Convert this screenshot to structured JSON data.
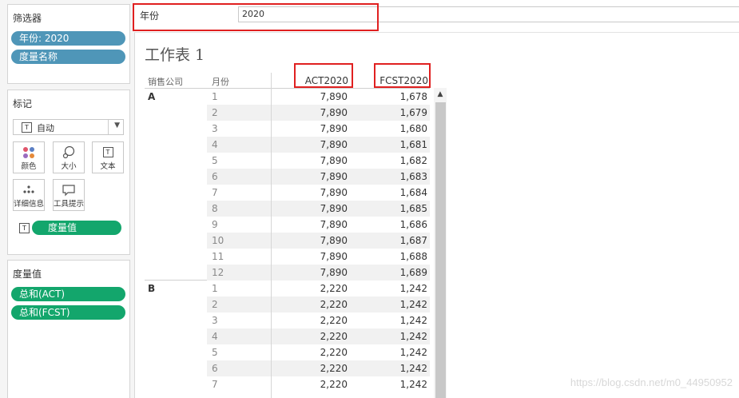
{
  "left_pane": {
    "filters": {
      "title": "筛选器",
      "pills": [
        "年份: 2020",
        "度量名称"
      ]
    },
    "marks": {
      "title": "标记",
      "mark_type": "自动",
      "buttons": {
        "color": "颜色",
        "size": "大小",
        "text": "文本",
        "detail": "详细信息",
        "tooltip": "工具提示"
      },
      "text_pill": "度量值"
    },
    "measure_values": {
      "title": "度量值",
      "pills": [
        "总和(ACT)",
        "总和(FCST)"
      ]
    }
  },
  "filter_bar": {
    "label": "年份",
    "value": "2020"
  },
  "sheet": {
    "title": "工作表 1",
    "columns": {
      "company": "销售公司",
      "month": "月份",
      "act": "ACT2020",
      "fcst": "FCST2020"
    },
    "groups": [
      {
        "company": "A",
        "rows": [
          {
            "month": "1",
            "act": "7,890",
            "fcst": "1,678"
          },
          {
            "month": "2",
            "act": "7,890",
            "fcst": "1,679"
          },
          {
            "month": "3",
            "act": "7,890",
            "fcst": "1,680"
          },
          {
            "month": "4",
            "act": "7,890",
            "fcst": "1,681"
          },
          {
            "month": "5",
            "act": "7,890",
            "fcst": "1,682"
          },
          {
            "month": "6",
            "act": "7,890",
            "fcst": "1,683"
          },
          {
            "month": "7",
            "act": "7,890",
            "fcst": "1,684"
          },
          {
            "month": "8",
            "act": "7,890",
            "fcst": "1,685"
          },
          {
            "month": "9",
            "act": "7,890",
            "fcst": "1,686"
          },
          {
            "month": "10",
            "act": "7,890",
            "fcst": "1,687"
          },
          {
            "month": "11",
            "act": "7,890",
            "fcst": "1,688"
          },
          {
            "month": "12",
            "act": "7,890",
            "fcst": "1,689"
          }
        ]
      },
      {
        "company": "B",
        "rows": [
          {
            "month": "1",
            "act": "2,220",
            "fcst": "1,242"
          },
          {
            "month": "2",
            "act": "2,220",
            "fcst": "1,242"
          },
          {
            "month": "3",
            "act": "2,220",
            "fcst": "1,242"
          },
          {
            "month": "4",
            "act": "2,220",
            "fcst": "1,242"
          },
          {
            "month": "5",
            "act": "2,220",
            "fcst": "1,242"
          },
          {
            "month": "6",
            "act": "2,220",
            "fcst": "1,242"
          },
          {
            "month": "7",
            "act": "2,220",
            "fcst": "1,242"
          }
        ]
      }
    ]
  },
  "watermark": "https://blog.csdn.net/m0_44950952",
  "colors": {
    "filter_pill": "#4f96b8",
    "measure_pill": "#13a66c",
    "highlight_box": "#e02020"
  }
}
